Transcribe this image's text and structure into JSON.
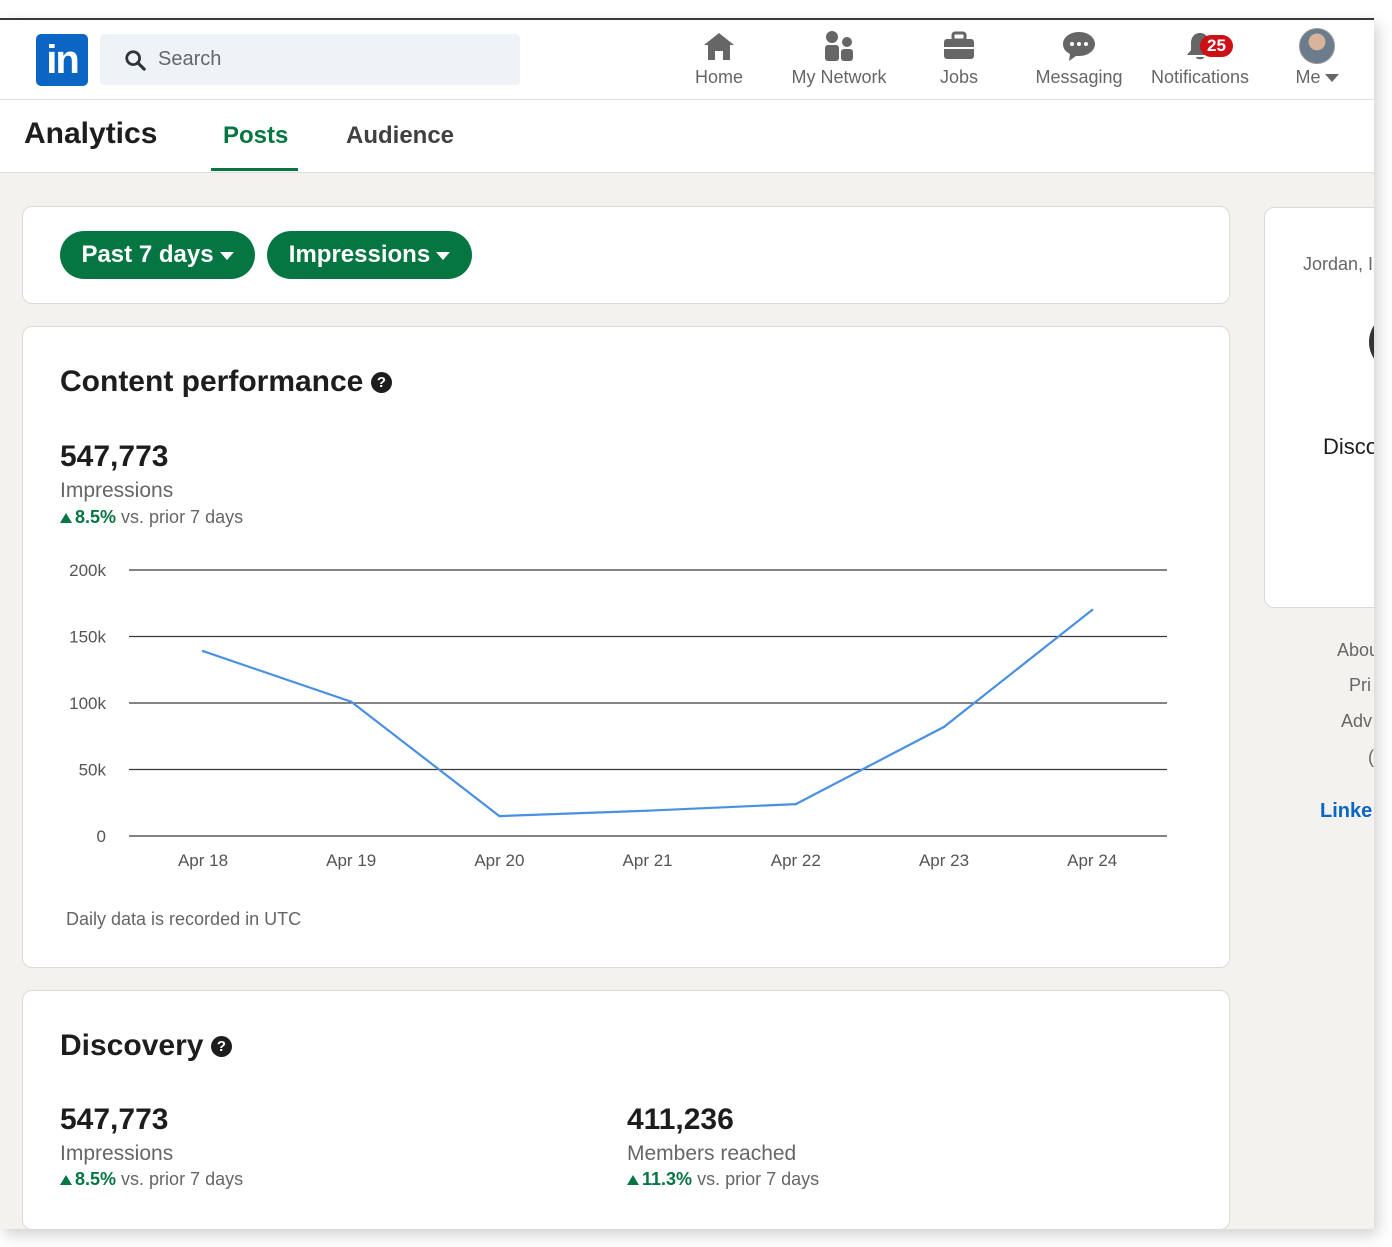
{
  "nav": {
    "search_placeholder": "Search",
    "items": [
      {
        "label": "Home",
        "icon": "home-icon"
      },
      {
        "label": "My Network",
        "icon": "network-icon"
      },
      {
        "label": "Jobs",
        "icon": "briefcase-icon"
      },
      {
        "label": "Messaging",
        "icon": "messaging-icon"
      },
      {
        "label": "Notifications",
        "icon": "bell-icon",
        "badge": "25"
      },
      {
        "label": "Me",
        "icon": "avatar"
      }
    ]
  },
  "subnav": {
    "title": "Analytics",
    "tabs": [
      {
        "label": "Posts",
        "active": true
      },
      {
        "label": "Audience",
        "active": false
      }
    ]
  },
  "filters": {
    "range": "Past 7 days",
    "metric": "Impressions"
  },
  "content_performance": {
    "title": "Content performance",
    "help": "?",
    "value": "547,773",
    "label": "Impressions",
    "delta": "8.5%",
    "delta_suffix": "vs. prior 7 days",
    "note": "Daily data is recorded in UTC"
  },
  "chart_data": {
    "type": "line",
    "categories": [
      "Apr 18",
      "Apr 19",
      "Apr 20",
      "Apr 21",
      "Apr 22",
      "Apr 23",
      "Apr 24"
    ],
    "series": [
      {
        "values": [
          139000,
          101000,
          15000,
          19000,
          24000,
          82000,
          170000
        ]
      }
    ],
    "yticks": [
      "200k",
      "150k",
      "100k",
      "50k",
      "0"
    ],
    "ylim": [
      0,
      200000
    ],
    "grid": true,
    "line_color": "#4a90e2"
  },
  "discovery": {
    "title": "Discovery",
    "help": "?",
    "metrics": [
      {
        "value": "547,773",
        "label": "Impressions",
        "delta": "8.5%",
        "delta_suffix": "vs. prior 7 days"
      },
      {
        "value": "411,236",
        "label": "Members reached",
        "delta": "11.3%",
        "delta_suffix": "vs. prior 7 days"
      }
    ]
  },
  "side": {
    "name_partial": "Jordan, I",
    "heading_partial": "Disco",
    "links": [
      "Abou",
      "Pri",
      "Adv",
      "("
    ],
    "brand_partial": "Linke"
  },
  "colors": {
    "brand": "#0a66c2",
    "accent_green": "#057642",
    "badge_red": "#cc1016"
  }
}
